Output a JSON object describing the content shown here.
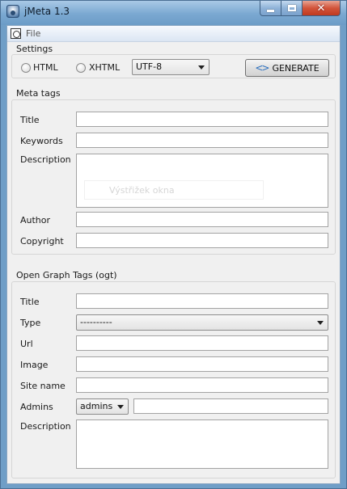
{
  "window": {
    "title": "jMeta 1.3",
    "close_glyph": "✕"
  },
  "menubar": {
    "items": [
      {
        "label": "File"
      }
    ]
  },
  "settings": {
    "title": "Settings",
    "radio_html": "HTML",
    "radio_xhtml": "XHTML",
    "encoding": "UTF-8",
    "generate_label": "GENERATE",
    "generate_icon": "<>"
  },
  "meta_tags": {
    "title": "Meta tags",
    "fields": {
      "title": {
        "label": "Title",
        "value": ""
      },
      "keywords": {
        "label": "Keywords",
        "value": ""
      },
      "description": {
        "label": "Description",
        "value": ""
      },
      "author": {
        "label": "Author",
        "value": ""
      },
      "copyright": {
        "label": "Copyright",
        "value": ""
      }
    },
    "ghost_text": "Výstřižek okna"
  },
  "ogt": {
    "title": "Open Graph Tags (ogt)",
    "fields": {
      "title": {
        "label": "Title",
        "value": ""
      },
      "type": {
        "label": "Type",
        "value": "----------"
      },
      "url": {
        "label": "Url",
        "value": ""
      },
      "image": {
        "label": "Image",
        "value": ""
      },
      "site_name": {
        "label": "Site name",
        "value": ""
      },
      "admins": {
        "label": "Admins",
        "select": "admins",
        "value": ""
      },
      "description": {
        "label": "Description",
        "value": ""
      }
    }
  },
  "colors": {
    "window_frame": "#6f9ec7",
    "client_bg": "#f0f0f0",
    "close_button": "#c0391f"
  }
}
